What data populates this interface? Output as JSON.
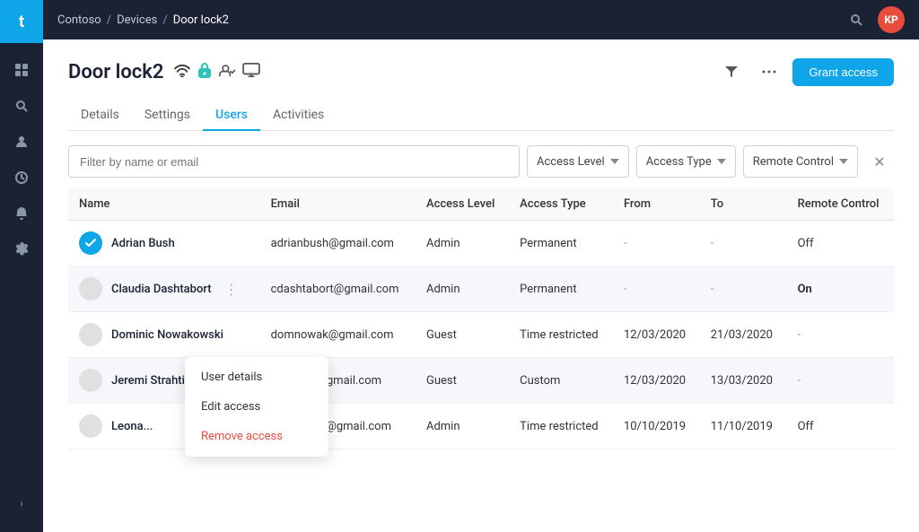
{
  "app": {
    "logo": "t",
    "breadcrumb": [
      "Contoso",
      "Devices",
      "Door lock2"
    ],
    "avatar": "KP"
  },
  "sidebar": {
    "items": [
      {
        "id": "grid",
        "icon": "⊞"
      },
      {
        "id": "search",
        "icon": "🔍"
      },
      {
        "id": "user",
        "icon": "👤"
      },
      {
        "id": "clock",
        "icon": "⏱"
      },
      {
        "id": "bell",
        "icon": "🔔"
      },
      {
        "id": "gear",
        "icon": "⚙"
      }
    ],
    "expand_label": "›"
  },
  "page": {
    "title": "Door lock2",
    "tabs": [
      "Details",
      "Settings",
      "Users",
      "Activities"
    ],
    "active_tab": "Users",
    "grant_button": "Grant access",
    "filter_placeholder": "Filter by name or email",
    "filter_dropdowns": [
      "Access Level",
      "Access Type",
      "Remote Control"
    ],
    "table": {
      "columns": [
        "Name",
        "Email",
        "Access Level",
        "Access Type",
        "From",
        "To",
        "Remote Control"
      ],
      "rows": [
        {
          "name": "Adrian Bush",
          "email": "adrianbush@gmail.com",
          "access_level": "Admin",
          "access_type": "Permanent",
          "from": "-",
          "to": "-",
          "remote_control": "Off",
          "checked": true
        },
        {
          "name": "Claudia Dashtabort",
          "email": "cdashtabort@gmail.com",
          "access_level": "Admin",
          "access_type": "Permanent",
          "from": "-",
          "to": "-",
          "remote_control": "On",
          "checked": false,
          "has_menu": true
        },
        {
          "name": "Dominic Nowakowski",
          "email": "domnowak@gmail.com",
          "access_level": "Guest",
          "access_type": "Time restricted",
          "from": "12/03/2020",
          "to": "21/03/2020",
          "remote_control": "-",
          "checked": false
        },
        {
          "name": "Jeremi Strahtish",
          "email": "strahtish@gmail.com",
          "access_level": "Guest",
          "access_type": "Custom",
          "from": "12/03/2020",
          "to": "13/03/2020",
          "remote_control": "-",
          "checked": false,
          "has_menu": true,
          "menu_open": true
        },
        {
          "name": "Leona...",
          "email": "leonardo.o@gmail.com",
          "access_level": "Admin",
          "access_type": "Time restricted",
          "from": "10/10/2019",
          "to": "11/10/2019",
          "remote_control": "Off",
          "checked": false
        }
      ]
    },
    "context_menu": {
      "items": [
        "User details",
        "Edit access",
        "Remove access"
      ],
      "danger_item": "Remove access"
    }
  }
}
